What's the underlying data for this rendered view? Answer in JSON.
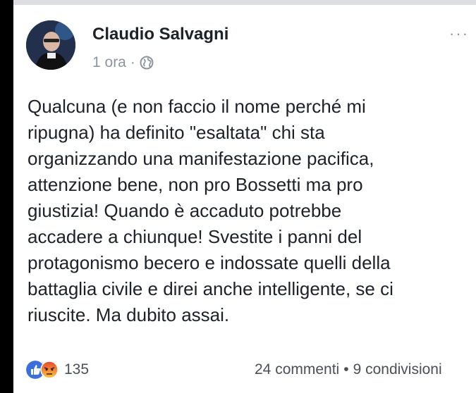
{
  "post": {
    "author": "Claudio Salvagni",
    "time": "1 ora",
    "separator": "·",
    "more_label": "···",
    "text": "Qualcuna (e non faccio il nome perché mi\nripugna) ha definito \"esaltata\" chi sta\norganizzando una manifestazione pacifica,\nattenzione bene, non pro Bossetti ma pro\ngiustizia! Quando è accaduto potrebbe\naccadere a chiunque! Svestite i panni del\nprotagonismo becero e indossate quelli della\nbattaglia civile e direi anche intelligente, se ci\nriuscite. Ma dubito assai."
  },
  "footer": {
    "reaction_count": "135",
    "comments": "24 commenti",
    "separator": "•",
    "shares": "9 condivisioni"
  },
  "icons": {
    "audience": "globe-icon",
    "like": "like-reaction-icon",
    "angry": "angry-reaction-icon"
  },
  "colors": {
    "like_blue": "#3b6fe0",
    "angry_orange": "#f26b2a",
    "meta_gray": "#8d949e"
  }
}
